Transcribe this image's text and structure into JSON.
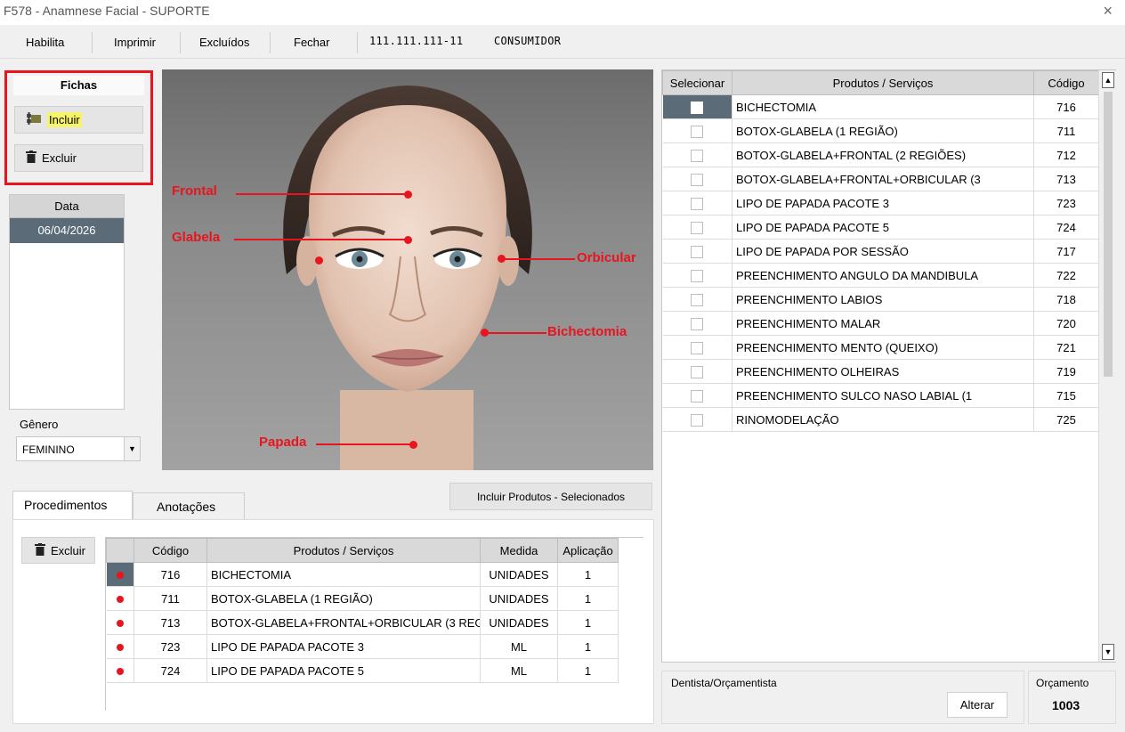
{
  "window": {
    "title": "F578 - Anamnese Facial  - SUPORTE",
    "close_icon": "×"
  },
  "menu": {
    "habilita": "Habilita",
    "imprimir": "Imprimir",
    "excluidos": "Excluídos",
    "fechar": "Fechar",
    "doc": "111.111.111-11",
    "cliente": "CONSUMIDOR"
  },
  "fichas": {
    "title": "Fichas",
    "incluir": "Incluir",
    "excluir": "Excluir"
  },
  "datas": {
    "header": "Data",
    "rows": [
      "06/04/2026"
    ]
  },
  "genero": {
    "label": "Gênero",
    "value": "FEMININO"
  },
  "face_labels": {
    "frontal": "Frontal",
    "glabela": "Glabela",
    "orbicular": "Orbicular",
    "bichectomia": "Bichectomia",
    "papada": "Papada"
  },
  "tabs": {
    "procedimentos": "Procedimentos",
    "anotacoes": "Anotações"
  },
  "incluir_selecionados": "Incluir Produtos - Selecionados",
  "proc_excluir": "Excluir",
  "proc_grid": {
    "headers": [
      "Código",
      "Produtos / Serviços",
      "Medida",
      "Aplicação"
    ],
    "rows": [
      {
        "codigo": "716",
        "produto": "BICHECTOMIA",
        "medida": "UNIDADES",
        "aplicacao": "1"
      },
      {
        "codigo": "711",
        "produto": "BOTOX-GLABELA (1 REGIÃO)",
        "medida": "UNIDADES",
        "aplicacao": "1"
      },
      {
        "codigo": "713",
        "produto": "BOTOX-GLABELA+FRONTAL+ORBICULAR (3 REG",
        "medida": "UNIDADES",
        "aplicacao": "1"
      },
      {
        "codigo": "723",
        "produto": "LIPO DE PAPADA PACOTE 3",
        "medida": "ML",
        "aplicacao": "1"
      },
      {
        "codigo": "724",
        "produto": "LIPO DE PAPADA PACOTE 5",
        "medida": "ML",
        "aplicacao": "1"
      }
    ]
  },
  "prod_grid": {
    "headers": [
      "Selecionar",
      "Produtos / Serviços",
      "Código"
    ],
    "rows": [
      {
        "produto": "BICHECTOMIA",
        "codigo": "716"
      },
      {
        "produto": "BOTOX-GLABELA (1 REGIÃO)",
        "codigo": "711"
      },
      {
        "produto": "BOTOX-GLABELA+FRONTAL (2 REGIÕES)",
        "codigo": "712"
      },
      {
        "produto": "BOTOX-GLABELA+FRONTAL+ORBICULAR (3",
        "codigo": "713"
      },
      {
        "produto": "LIPO DE PAPADA PACOTE 3",
        "codigo": "723"
      },
      {
        "produto": "LIPO DE PAPADA PACOTE 5",
        "codigo": "724"
      },
      {
        "produto": "LIPO DE PAPADA POR SESSÃO",
        "codigo": "717"
      },
      {
        "produto": "PREENCHIMENTO ANGULO DA MANDIBULA",
        "codigo": "722"
      },
      {
        "produto": "PREENCHIMENTO LABIOS",
        "codigo": "718"
      },
      {
        "produto": "PREENCHIMENTO MALAR",
        "codigo": "720"
      },
      {
        "produto": "PREENCHIMENTO MENTO (QUEIXO)",
        "codigo": "721"
      },
      {
        "produto": "PREENCHIMENTO OLHEIRAS",
        "codigo": "719"
      },
      {
        "produto": "PREENCHIMENTO SULCO NASO LABIAL (1",
        "codigo": "715"
      },
      {
        "produto": "RINOMODELAÇÃO",
        "codigo": "725"
      }
    ]
  },
  "dentista": {
    "label": "Dentista/Orçamentista",
    "alterar": "Alterar"
  },
  "orcamento": {
    "label": "Orçamento",
    "value": "1003"
  },
  "colors": {
    "accent_red": "#e8141e",
    "selected_row": "#5b6b78"
  }
}
